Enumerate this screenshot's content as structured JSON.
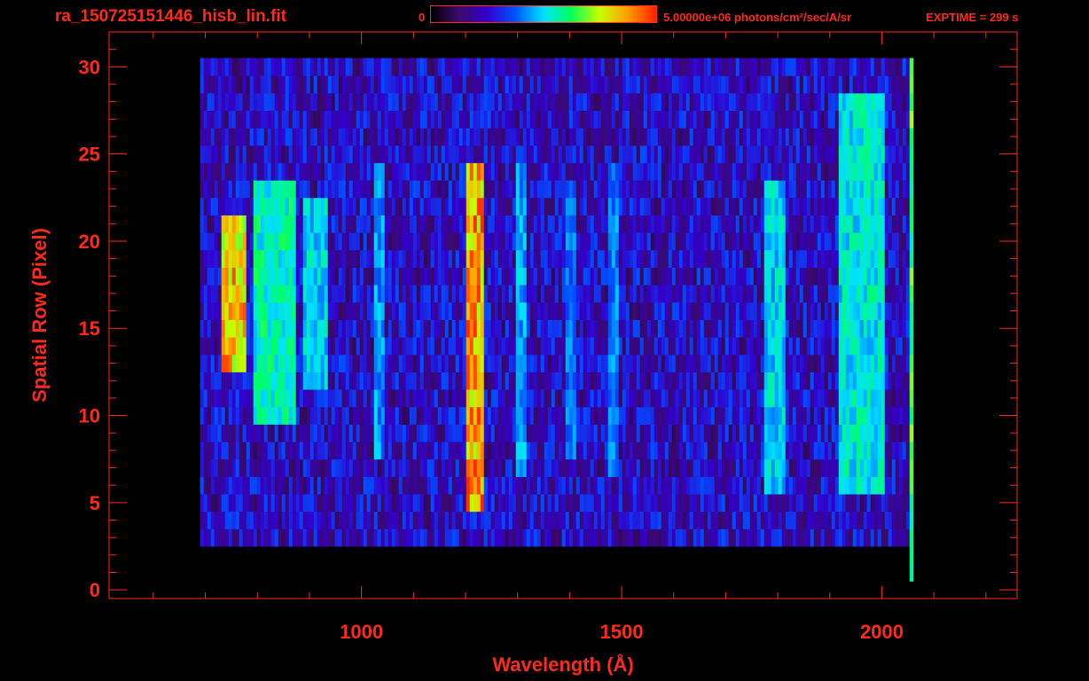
{
  "header": {
    "file_title": "ra_150725151446_hisb_lin.fit",
    "colorbar_min": "0",
    "colorbar_max": "5.00000e+06 photons/cm²/sec/A/sr",
    "exptime": "EXPTIME = 299 s"
  },
  "colors": {
    "axis": "#ff2a1a",
    "background": "#000000",
    "colormap": [
      "#000000",
      "#3a0a6a",
      "#3300cc",
      "#0050ff",
      "#00e0ff",
      "#00ff60",
      "#c8ff00",
      "#ffa000",
      "#ff1e00"
    ]
  },
  "chart_data": {
    "type": "heatmap",
    "xlabel": "Wavelength (Å)",
    "ylabel": "Spatial Row (Pixel)",
    "xlim": [
      515,
      2260
    ],
    "ylim": [
      -0.5,
      32
    ],
    "x_ticks": [
      1000,
      1500,
      2000
    ],
    "y_ticks": [
      0,
      5,
      10,
      15,
      20,
      25,
      30
    ],
    "color_scale": {
      "min": 0,
      "max": 5000000,
      "unit": "photons/cm²/sec/A/sr"
    },
    "grid": false,
    "rows": {
      "first": 0,
      "last": 30
    },
    "bands": [
      {
        "x_center": 750,
        "x_width": 45,
        "row_min": 13,
        "row_max": 21,
        "level": 0.92
      },
      {
        "x_center": 830,
        "x_width": 85,
        "row_min": 10,
        "row_max": 23,
        "level": 0.62
      },
      {
        "x_center": 910,
        "x_width": 50,
        "row_min": 12,
        "row_max": 22,
        "level": 0.55
      },
      {
        "x_center": 1030,
        "x_width": 22,
        "row_min": 8,
        "row_max": 24,
        "level": 0.48
      },
      {
        "x_center": 1215,
        "x_width": 32,
        "row_min": 5,
        "row_max": 24,
        "level": 0.95
      },
      {
        "x_center": 1305,
        "x_width": 22,
        "row_min": 7,
        "row_max": 24,
        "level": 0.5
      },
      {
        "x_center": 1400,
        "x_width": 18,
        "row_min": 8,
        "row_max": 23,
        "level": 0.44
      },
      {
        "x_center": 1480,
        "x_width": 18,
        "row_min": 7,
        "row_max": 24,
        "level": 0.46
      },
      {
        "x_center": 1790,
        "x_width": 40,
        "row_min": 6,
        "row_max": 23,
        "level": 0.55
      },
      {
        "x_center": 1960,
        "x_width": 90,
        "row_min": 6,
        "row_max": 28,
        "level": 0.58
      },
      {
        "x_center": 2055,
        "x_width": 12,
        "row_min": 1,
        "row_max": 30,
        "level": 0.72
      }
    ],
    "background_region": {
      "x_min": 690,
      "x_max": 2060,
      "row_min": 3,
      "row_max": 30,
      "level": 0.3
    }
  }
}
